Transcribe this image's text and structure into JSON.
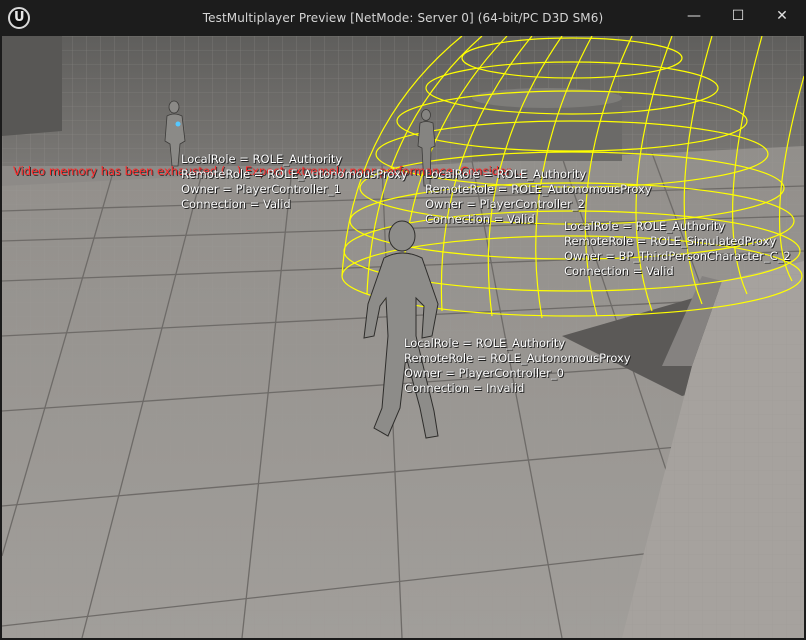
{
  "window": {
    "title": "TestMultiplayer Preview [NetMode: Server 0]  (64-bit/PC D3D SM6)",
    "logo_text": "U",
    "minimize_symbol": "—",
    "maximize_symbol": "☐",
    "close_symbol": "✕"
  },
  "warning": {
    "text": "Video memory has been exhausted (…) Expect extremely poor performance. Consider…",
    "color": "#ff2a2a"
  },
  "debug_labels": [
    {
      "lines": [
        "LocalRole = ROLE_Authority",
        "RemoteRole = ROLE_AutonomousProxy",
        "Owner = PlayerController_1",
        "Connection = Valid"
      ]
    },
    {
      "lines": [
        "LocalRole = ROLE_Authority",
        "RemoteRole = ROLE_AutonomousProxy",
        "Owner = PlayerController_2",
        "Connection = Valid"
      ]
    },
    {
      "lines": [
        "LocalRole = ROLE_Authority",
        "RemoteRole = ROLE_SimulatedProxy",
        "Owner = BP_ThirdPersonCharacter_C_2",
        "Connection = Valid"
      ]
    },
    {
      "lines": [
        "LocalRole = ROLE_Authority",
        "RemoteRole = ROLE_AutonomousProxy",
        "Owner = PlayerController_0",
        "Connection = Invalid"
      ]
    }
  ],
  "colors": {
    "debug_sphere": "#ffff00",
    "floor": "#8f8b87",
    "wall": "#6f6d6a"
  }
}
